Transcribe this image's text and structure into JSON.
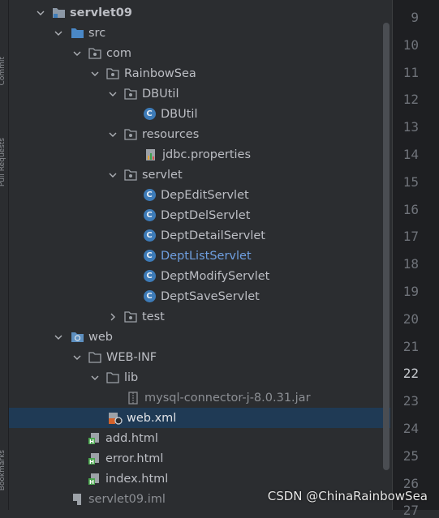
{
  "side_panel": {
    "labels": [
      "Commit",
      "Pull Requests",
      "Bookmarks"
    ]
  },
  "tree": {
    "rows": [
      {
        "label": "servlet09",
        "icon": "module-folder-icon",
        "expanded": true
      },
      {
        "label": "src",
        "icon": "source-folder-icon",
        "expanded": true
      },
      {
        "label": "com",
        "icon": "package-icon",
        "expanded": true
      },
      {
        "label": "RainbowSea",
        "icon": "package-icon",
        "expanded": true
      },
      {
        "label": "DBUtil",
        "icon": "package-icon",
        "expanded": true
      },
      {
        "label": "DBUtil",
        "icon": "java-class-icon"
      },
      {
        "label": "resources",
        "icon": "package-icon",
        "expanded": true
      },
      {
        "label": "jdbc.properties",
        "icon": "properties-file-icon"
      },
      {
        "label": "servlet",
        "icon": "package-icon",
        "expanded": true
      },
      {
        "label": "DepEditServlet",
        "icon": "java-class-icon"
      },
      {
        "label": "DeptDelServlet",
        "icon": "java-class-icon"
      },
      {
        "label": "DeptDetailServlet",
        "icon": "java-class-icon"
      },
      {
        "label": "DeptListServlet",
        "icon": "java-class-icon",
        "status": "modified"
      },
      {
        "label": "DeptModifyServlet",
        "icon": "java-class-icon"
      },
      {
        "label": "DeptSaveServlet",
        "icon": "java-class-icon"
      },
      {
        "label": "test",
        "icon": "package-icon",
        "expanded": false
      },
      {
        "label": "web",
        "icon": "web-folder-icon",
        "expanded": true
      },
      {
        "label": "WEB-INF",
        "icon": "folder-icon",
        "expanded": true
      },
      {
        "label": "lib",
        "icon": "folder-icon",
        "expanded": true
      },
      {
        "label": "mysql-connector-j-8.0.31.jar",
        "icon": "jar-file-icon",
        "status": "ignored"
      },
      {
        "label": "web.xml",
        "icon": "web-xml-icon",
        "selected": true
      },
      {
        "label": "add.html",
        "icon": "html-file-icon"
      },
      {
        "label": "error.html",
        "icon": "html-file-icon"
      },
      {
        "label": "index.html",
        "icon": "html-file-icon"
      },
      {
        "label": "servlet09.iml",
        "icon": "iml-file-icon",
        "status": "ignored"
      }
    ]
  },
  "editor_gutter": {
    "line_numbers": [
      "9",
      "10",
      "11",
      "12",
      "13",
      "14",
      "15",
      "16",
      "17",
      "18",
      "19",
      "20",
      "21",
      "22",
      "23",
      "24",
      "25",
      "26",
      "27"
    ],
    "current_line": "22"
  },
  "watermark": "CSDN @ChinaRainbowSea",
  "colors": {
    "background": "#2b2d30",
    "selection": "#1f3a55",
    "modified_text": "#6f9fe0",
    "class_icon": "#3d7bb8",
    "gutter_background": "#1e1f22"
  }
}
